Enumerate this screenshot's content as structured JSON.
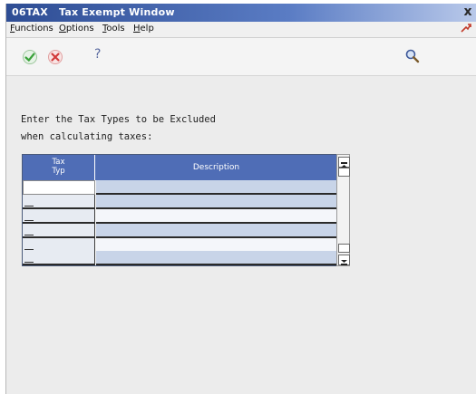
{
  "window": {
    "title": "06TAX   Tax Exempt Window",
    "close_glyph": "x"
  },
  "menubar": {
    "items": [
      "Functions",
      "Options",
      "Tools",
      "Help"
    ]
  },
  "toolbar": {
    "ok_icon": "checkmark-icon",
    "cancel_icon": "cancel-x-icon",
    "help_glyph": "?",
    "search_icon": "magnifier-icon"
  },
  "content": {
    "prompt_line1": "Enter the Tax Types to be Excluded",
    "prompt_line2": "when calculating taxes:"
  },
  "grid": {
    "columns": [
      "Tax\nTyp",
      "Description"
    ],
    "rows": [
      {
        "tax_type": "",
        "description": ""
      },
      {
        "tax_type": "",
        "description": ""
      },
      {
        "tax_type": "",
        "description": ""
      },
      {
        "tax_type": "",
        "description": ""
      },
      {
        "tax_type": "",
        "description": ""
      },
      {
        "tax_type": "",
        "description": ""
      }
    ]
  },
  "colors": {
    "title_bar": "#2e4d94",
    "grid_header": "#4f6db6",
    "row_shade": "#c8d4e8",
    "ok_green": "#3aa13a",
    "cancel_red": "#d23b3b"
  }
}
